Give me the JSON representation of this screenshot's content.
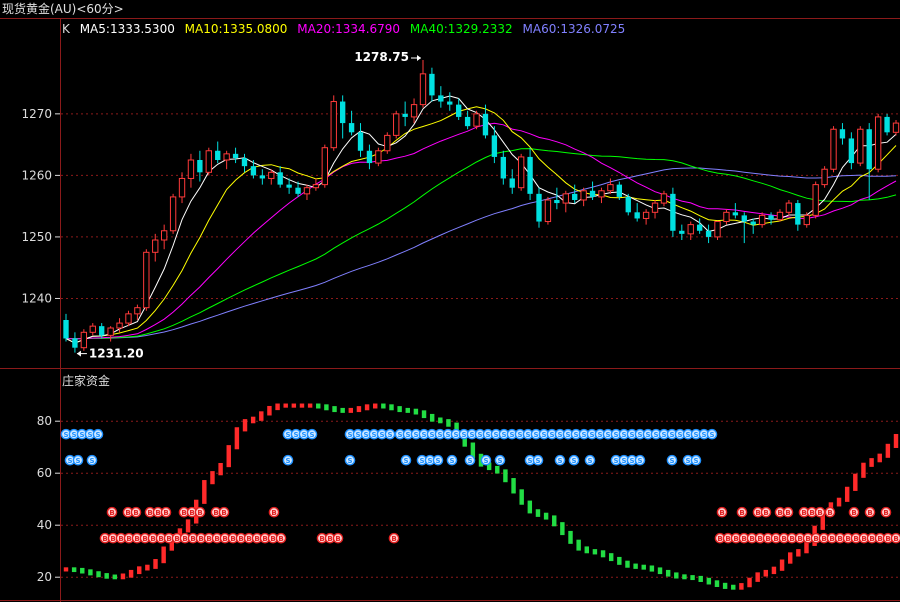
{
  "window": {
    "title": "现货黄金(AU)<60分>"
  },
  "colors": {
    "up": "#ff3a3a",
    "down": "#00e0e0",
    "grid": "#8b1a1a",
    "axis_text": "#dcdcdc",
    "ma5": "#ffffff",
    "ma10": "#ffff00",
    "ma20": "#ff00ff",
    "ma40": "#00ff00",
    "ma60": "#8080ff",
    "bar_up": "#ff2a2a",
    "bar_down": "#22dd44",
    "badge_blue": "#1e90ff",
    "badge_red": "#e02020"
  },
  "legend": {
    "k_label": "K",
    "ma5": "MA5:1333.5300",
    "ma10": "MA10:1335.0800",
    "ma20": "MA20:1334.6790",
    "ma40": "MA40:1329.2332",
    "ma60": "MA60:1326.0725"
  },
  "annotations": {
    "high": "1278.75",
    "low": "1231.20"
  },
  "badges": {
    "blue_letter": "S",
    "red_letter": "B"
  },
  "chart_data": [
    {
      "type": "candlestick",
      "name": "price",
      "y_ticks": [
        "1240",
        "1250",
        "1260",
        "1270"
      ],
      "ylim": [
        1230,
        1282
      ],
      "grid": true,
      "candles": [
        [
          1236.5,
          1237.5,
          1233.0,
          1233.5
        ],
        [
          1233.5,
          1234.5,
          1231.2,
          1232.0
        ],
        [
          1232.0,
          1235.0,
          1231.5,
          1234.5
        ],
        [
          1234.5,
          1236.0,
          1234.0,
          1235.5
        ],
        [
          1235.5,
          1236.0,
          1233.5,
          1234.0
        ],
        [
          1234.0,
          1235.5,
          1233.0,
          1235.2
        ],
        [
          1235.2,
          1236.8,
          1234.5,
          1236.0
        ],
        [
          1236.0,
          1238.0,
          1235.5,
          1237.5
        ],
        [
          1237.5,
          1239.0,
          1236.5,
          1238.5
        ],
        [
          1238.5,
          1248.0,
          1238.0,
          1247.5
        ],
        [
          1247.5,
          1250.5,
          1246.0,
          1249.5
        ],
        [
          1249.5,
          1252.0,
          1248.0,
          1251.0
        ],
        [
          1251.0,
          1257.0,
          1250.5,
          1256.5
        ],
        [
          1256.5,
          1260.5,
          1255.5,
          1259.5
        ],
        [
          1259.5,
          1263.5,
          1258.0,
          1262.5
        ],
        [
          1262.5,
          1264.0,
          1259.0,
          1260.5
        ],
        [
          1260.5,
          1264.5,
          1260.0,
          1264.0
        ],
        [
          1264.0,
          1265.5,
          1262.0,
          1262.5
        ],
        [
          1262.5,
          1264.0,
          1261.0,
          1263.5
        ],
        [
          1263.5,
          1264.5,
          1262.0,
          1262.8
        ],
        [
          1262.8,
          1263.5,
          1260.5,
          1261.5
        ],
        [
          1261.5,
          1262.5,
          1259.5,
          1260.0
        ],
        [
          1260.0,
          1261.0,
          1258.5,
          1259.5
        ],
        [
          1259.5,
          1261.0,
          1258.5,
          1260.5
        ],
        [
          1260.5,
          1261.5,
          1258.0,
          1258.5
        ],
        [
          1258.5,
          1259.5,
          1257.0,
          1258.0
        ],
        [
          1258.0,
          1259.0,
          1256.5,
          1257.0
        ],
        [
          1257.0,
          1258.5,
          1256.0,
          1258.0
        ],
        [
          1258.0,
          1259.5,
          1257.5,
          1258.5
        ],
        [
          1258.5,
          1265.0,
          1258.0,
          1264.5
        ],
        [
          1264.5,
          1273.0,
          1264.0,
          1272.0
        ],
        [
          1272.0,
          1273.0,
          1266.0,
          1268.5
        ],
        [
          1268.5,
          1270.5,
          1266.5,
          1267.0
        ],
        [
          1267.0,
          1268.5,
          1263.0,
          1264.0
        ],
        [
          1264.0,
          1265.0,
          1261.0,
          1262.0
        ],
        [
          1262.0,
          1264.5,
          1261.5,
          1264.0
        ],
        [
          1264.0,
          1267.0,
          1263.5,
          1266.5
        ],
        [
          1266.5,
          1270.5,
          1266.0,
          1270.0
        ],
        [
          1270.0,
          1272.0,
          1268.0,
          1269.5
        ],
        [
          1269.5,
          1272.5,
          1268.5,
          1271.5
        ],
        [
          1271.5,
          1278.75,
          1271.0,
          1276.5
        ],
        [
          1276.5,
          1277.5,
          1272.0,
          1273.0
        ],
        [
          1273.0,
          1274.5,
          1271.0,
          1272.0
        ],
        [
          1272.0,
          1273.5,
          1270.5,
          1271.5
        ],
        [
          1271.5,
          1272.5,
          1269.0,
          1269.5
        ],
        [
          1269.5,
          1270.5,
          1267.5,
          1268.0
        ],
        [
          1268.0,
          1270.5,
          1267.5,
          1270.0
        ],
        [
          1270.0,
          1271.5,
          1266.0,
          1266.5
        ],
        [
          1266.5,
          1268.0,
          1262.0,
          1263.0
        ],
        [
          1263.0,
          1264.0,
          1258.5,
          1259.5
        ],
        [
          1259.5,
          1261.0,
          1257.0,
          1258.0
        ],
        [
          1258.0,
          1263.5,
          1257.5,
          1263.0
        ],
        [
          1263.0,
          1264.5,
          1256.0,
          1257.0
        ],
        [
          1257.0,
          1258.0,
          1251.5,
          1252.5
        ],
        [
          1252.5,
          1256.5,
          1252.0,
          1256.0
        ],
        [
          1256.0,
          1258.0,
          1254.5,
          1255.5
        ],
        [
          1255.5,
          1257.5,
          1254.0,
          1257.0
        ],
        [
          1257.0,
          1258.5,
          1255.5,
          1256.0
        ],
        [
          1256.0,
          1258.0,
          1255.0,
          1257.5
        ],
        [
          1257.5,
          1259.0,
          1256.0,
          1256.5
        ],
        [
          1256.5,
          1258.0,
          1255.5,
          1257.5
        ],
        [
          1257.5,
          1259.5,
          1257.0,
          1258.5
        ],
        [
          1258.5,
          1259.0,
          1256.0,
          1256.5
        ],
        [
          1256.5,
          1257.0,
          1253.5,
          1254.0
        ],
        [
          1254.0,
          1255.5,
          1252.5,
          1253.0
        ],
        [
          1253.0,
          1254.5,
          1252.0,
          1254.0
        ],
        [
          1254.0,
          1256.0,
          1253.0,
          1255.5
        ],
        [
          1255.5,
          1257.5,
          1255.0,
          1257.0
        ],
        [
          1257.0,
          1258.0,
          1250.0,
          1251.0
        ],
        [
          1251.0,
          1252.0,
          1249.5,
          1250.5
        ],
        [
          1250.5,
          1252.5,
          1249.5,
          1252.0
        ],
        [
          1252.0,
          1253.0,
          1250.5,
          1251.0
        ],
        [
          1251.0,
          1252.0,
          1249.0,
          1250.0
        ],
        [
          1250.0,
          1252.5,
          1249.5,
          1252.5
        ],
        [
          1252.5,
          1254.5,
          1252.0,
          1254.0
        ],
        [
          1254.0,
          1255.5,
          1253.0,
          1253.5
        ],
        [
          1253.5,
          1254.0,
          1249.0,
          1252.5
        ],
        [
          1252.5,
          1253.0,
          1250.5,
          1252.0
        ],
        [
          1252.0,
          1254.0,
          1251.5,
          1253.5
        ],
        [
          1253.5,
          1254.0,
          1252.0,
          1252.8
        ],
        [
          1252.8,
          1254.5,
          1252.5,
          1254.0
        ],
        [
          1254.0,
          1256.0,
          1253.5,
          1255.5
        ],
        [
          1255.5,
          1256.0,
          1251.0,
          1252.0
        ],
        [
          1252.0,
          1254.0,
          1251.5,
          1253.5
        ],
        [
          1253.5,
          1259.0,
          1253.0,
          1258.5
        ],
        [
          1258.5,
          1261.5,
          1258.0,
          1261.0
        ],
        [
          1261.0,
          1268.0,
          1260.5,
          1267.5
        ],
        [
          1267.5,
          1268.5,
          1265.0,
          1266.0
        ],
        [
          1266.0,
          1267.0,
          1261.0,
          1262.0
        ],
        [
          1262.0,
          1268.0,
          1261.5,
          1267.5
        ],
        [
          1267.5,
          1268.5,
          1256.0,
          1261.0
        ],
        [
          1261.0,
          1270.0,
          1260.5,
          1269.5
        ],
        [
          1269.5,
          1270.0,
          1266.5,
          1267.0
        ],
        [
          1267.0,
          1269.0,
          1266.5,
          1268.5
        ]
      ]
    },
    {
      "type": "bar",
      "name": "庄家资金",
      "y_ticks": [
        "20",
        "40",
        "60",
        "80"
      ],
      "ylim": [
        12,
        92
      ],
      "grid": true
    }
  ]
}
